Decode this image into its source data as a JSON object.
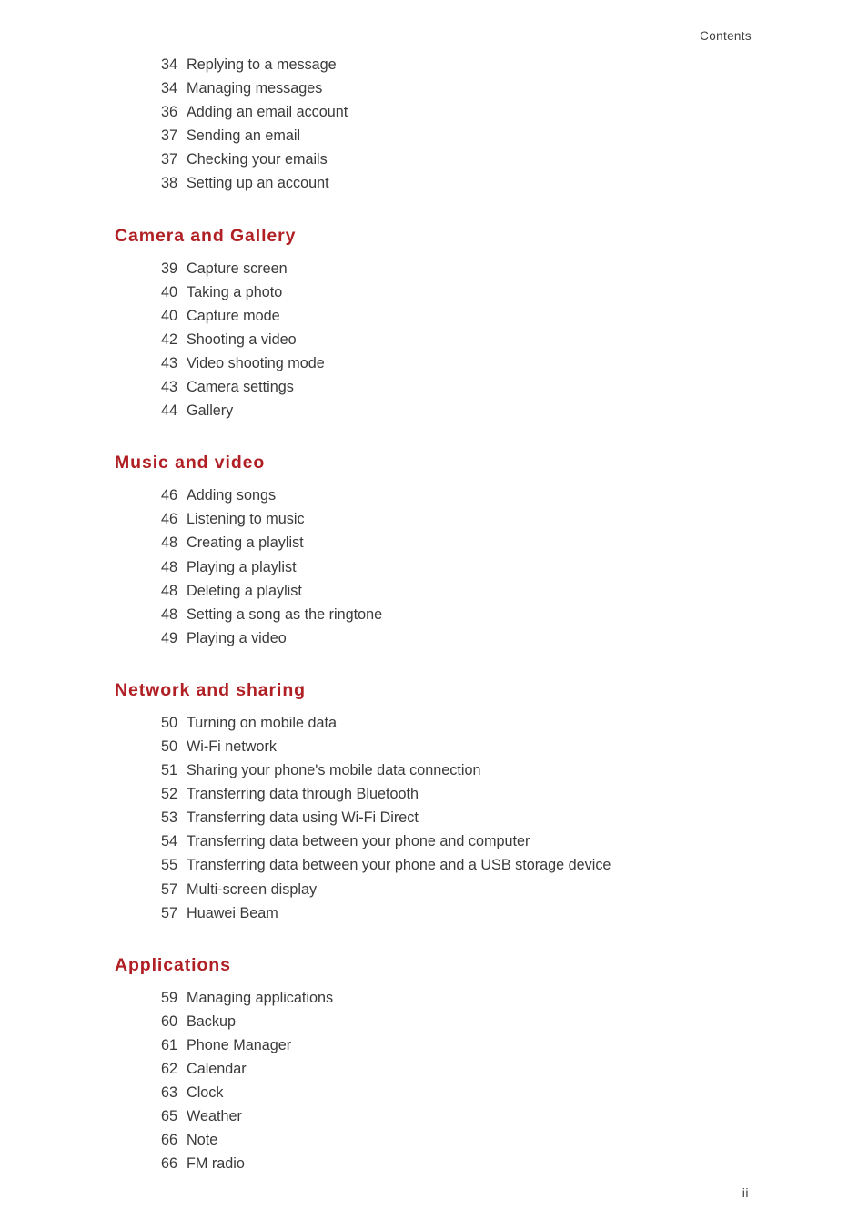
{
  "document": {
    "running_header": "Contents",
    "folio": "ii",
    "heading_color": "#b01f24",
    "body_color": "#3a3a3a",
    "background_color": "#ffffff"
  },
  "toc": {
    "blocks": [
      {
        "heading": null,
        "entries": [
          {
            "page": "34",
            "title": "Replying to a message"
          },
          {
            "page": "34",
            "title": "Managing messages"
          },
          {
            "page": "36",
            "title": "Adding an email account"
          },
          {
            "page": "37",
            "title": "Sending an email"
          },
          {
            "page": "37",
            "title": "Checking your emails"
          },
          {
            "page": "38",
            "title": "Setting up an account"
          }
        ]
      },
      {
        "heading": "Camera and Gallery",
        "entries": [
          {
            "page": "39",
            "title": "Capture screen"
          },
          {
            "page": "40",
            "title": "Taking a photo"
          },
          {
            "page": "40",
            "title": "Capture mode"
          },
          {
            "page": "42",
            "title": "Shooting a video"
          },
          {
            "page": "43",
            "title": "Video shooting mode"
          },
          {
            "page": "43",
            "title": "Camera settings"
          },
          {
            "page": "44",
            "title": "Gallery"
          }
        ]
      },
      {
        "heading": "Music and video",
        "entries": [
          {
            "page": "46",
            "title": "Adding songs"
          },
          {
            "page": "46",
            "title": "Listening to music"
          },
          {
            "page": "48",
            "title": "Creating a playlist"
          },
          {
            "page": "48",
            "title": "Playing a playlist"
          },
          {
            "page": "48",
            "title": "Deleting a playlist"
          },
          {
            "page": "48",
            "title": "Setting a song as the ringtone"
          },
          {
            "page": "49",
            "title": "Playing a video"
          }
        ]
      },
      {
        "heading": "Network and sharing",
        "entries": [
          {
            "page": "50",
            "title": "Turning on mobile data"
          },
          {
            "page": "50",
            "title": "Wi-Fi network"
          },
          {
            "page": "51",
            "title": "Sharing your phone's mobile data connection"
          },
          {
            "page": "52",
            "title": "Transferring data through Bluetooth"
          },
          {
            "page": "53",
            "title": "Transferring data using Wi-Fi Direct"
          },
          {
            "page": "54",
            "title": "Transferring data between your phone and computer"
          },
          {
            "page": "55",
            "title": "Transferring data between your phone and a USB storage device"
          },
          {
            "page": "57",
            "title": "Multi-screen display"
          },
          {
            "page": "57",
            "title": "Huawei Beam"
          }
        ]
      },
      {
        "heading": "Applications",
        "entries": [
          {
            "page": "59",
            "title": "Managing applications"
          },
          {
            "page": "60",
            "title": "Backup"
          },
          {
            "page": "61",
            "title": "Phone Manager"
          },
          {
            "page": "62",
            "title": "Calendar"
          },
          {
            "page": "63",
            "title": "Clock"
          },
          {
            "page": "65",
            "title": "Weather"
          },
          {
            "page": "66",
            "title": "Note"
          },
          {
            "page": "66",
            "title": "FM radio"
          }
        ]
      }
    ]
  }
}
